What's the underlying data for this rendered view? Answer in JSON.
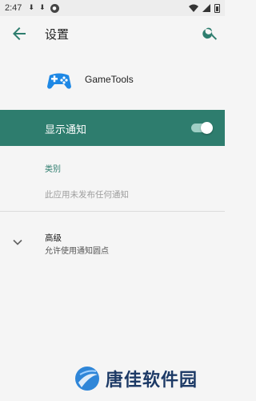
{
  "status_bar": {
    "time": "2:47",
    "icons": [
      "download-icon",
      "download-icon",
      "app-badge-icon"
    ],
    "right_icons": [
      "wifi-icon",
      "signal-icon",
      "battery-icon"
    ]
  },
  "toolbar": {
    "title": "设置"
  },
  "app": {
    "name": "GameTools",
    "icon_color": "#1e88e5"
  },
  "notification_toggle": {
    "label": "显示通知",
    "enabled": true,
    "accent_color": "#2e7d6e"
  },
  "category": {
    "header": "类别",
    "empty_text": "此应用未发布任何通知"
  },
  "advanced": {
    "title": "高级",
    "summary": "允许使用通知圆点"
  },
  "watermark": {
    "text": "唐佳软件园"
  }
}
